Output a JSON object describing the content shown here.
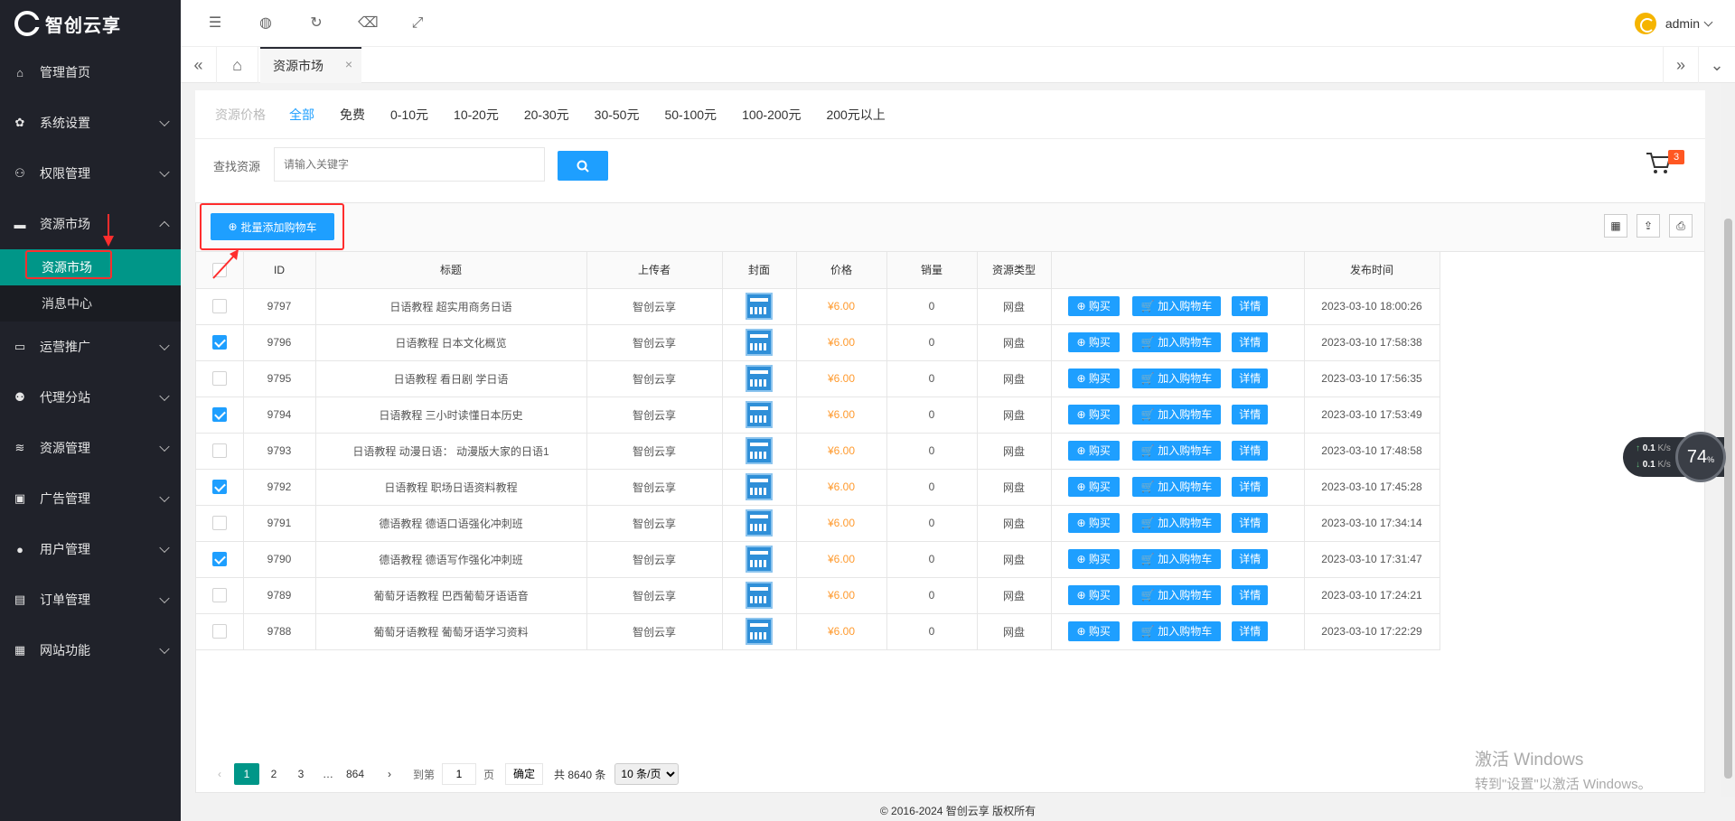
{
  "logo_text": "智创云享",
  "sidebar": {
    "items": [
      {
        "label": "管理首页",
        "icon": "home-icon",
        "glyph": "⌂"
      },
      {
        "label": "系统设置",
        "icon": "gear-icon",
        "glyph": "✿"
      },
      {
        "label": "权限管理",
        "icon": "users-icon",
        "glyph": "⚇"
      },
      {
        "label": "资源市场",
        "icon": "store-icon",
        "glyph": "▬"
      },
      {
        "label": "运营推广",
        "icon": "megaphone-icon",
        "glyph": "▭"
      },
      {
        "label": "代理分站",
        "icon": "sitemap-icon",
        "glyph": "⚉"
      },
      {
        "label": "资源管理",
        "icon": "layers-icon",
        "glyph": "≋"
      },
      {
        "label": "广告管理",
        "icon": "ad-icon",
        "glyph": "▣"
      },
      {
        "label": "用户管理",
        "icon": "user-icon",
        "glyph": "●"
      },
      {
        "label": "订单管理",
        "icon": "clipboard-icon",
        "glyph": "▤"
      },
      {
        "label": "网站功能",
        "icon": "grid-icon",
        "glyph": "▦"
      }
    ],
    "submenu": [
      {
        "label": "资源市场"
      },
      {
        "label": "消息中心"
      }
    ]
  },
  "header": {
    "username": "admin"
  },
  "tabbar": {
    "active_tab": "资源市场",
    "close": "×"
  },
  "filter": {
    "label": "资源价格",
    "options": [
      "全部",
      "免费",
      "0-10元",
      "10-20元",
      "20-30元",
      "30-50元",
      "50-100元",
      "100-200元",
      "200元以上"
    ]
  },
  "search": {
    "label": "查找资源",
    "placeholder": "请输入关键字"
  },
  "cart": {
    "count": "3"
  },
  "toolbar": {
    "batch_add": "批量添加购物车"
  },
  "table": {
    "headers": [
      "ID",
      "标题",
      "上传者",
      "封面",
      "价格",
      "销量",
      "资源类型",
      "",
      "发布时间"
    ],
    "buy_label": "购买",
    "add_cart_label": "加入购物车",
    "detail_label": "详情",
    "rows": [
      {
        "checked": false,
        "id": "9797",
        "title": "日语教程 超实用商务日语",
        "uploader": "智创云享",
        "price": "¥6.00",
        "sales": "0",
        "type": "网盘",
        "time": "2023-03-10 18:00:26"
      },
      {
        "checked": true,
        "id": "9796",
        "title": "日语教程 日本文化概览",
        "uploader": "智创云享",
        "price": "¥6.00",
        "sales": "0",
        "type": "网盘",
        "time": "2023-03-10 17:58:38"
      },
      {
        "checked": false,
        "id": "9795",
        "title": "日语教程 看日剧 学日语",
        "uploader": "智创云享",
        "price": "¥6.00",
        "sales": "0",
        "type": "网盘",
        "time": "2023-03-10 17:56:35"
      },
      {
        "checked": true,
        "id": "9794",
        "title": "日语教程 三小时读懂日本历史",
        "uploader": "智创云享",
        "price": "¥6.00",
        "sales": "0",
        "type": "网盘",
        "time": "2023-03-10 17:53:49"
      },
      {
        "checked": false,
        "id": "9793",
        "title": "日语教程 动漫日语： 动漫版大家的日语1",
        "uploader": "智创云享",
        "price": "¥6.00",
        "sales": "0",
        "type": "网盘",
        "time": "2023-03-10 17:48:58"
      },
      {
        "checked": true,
        "id": "9792",
        "title": "日语教程 职场日语资料教程",
        "uploader": "智创云享",
        "price": "¥6.00",
        "sales": "0",
        "type": "网盘",
        "time": "2023-03-10 17:45:28"
      },
      {
        "checked": false,
        "id": "9791",
        "title": "德语教程 德语口语强化冲刺班",
        "uploader": "智创云享",
        "price": "¥6.00",
        "sales": "0",
        "type": "网盘",
        "time": "2023-03-10 17:34:14"
      },
      {
        "checked": true,
        "id": "9790",
        "title": "德语教程 德语写作强化冲刺班",
        "uploader": "智创云享",
        "price": "¥6.00",
        "sales": "0",
        "type": "网盘",
        "time": "2023-03-10 17:31:47"
      },
      {
        "checked": false,
        "id": "9789",
        "title": "葡萄牙语教程 巴西葡萄牙语语音",
        "uploader": "智创云享",
        "price": "¥6.00",
        "sales": "0",
        "type": "网盘",
        "time": "2023-03-10 17:24:21"
      },
      {
        "checked": false,
        "id": "9788",
        "title": "葡萄牙语教程 葡萄牙语学习资料",
        "uploader": "智创云享",
        "price": "¥6.00",
        "sales": "0",
        "type": "网盘",
        "time": "2023-03-10 17:22:29"
      }
    ]
  },
  "pager": {
    "pages": [
      "1",
      "2",
      "3",
      "…",
      "864"
    ],
    "goto_label": "到第",
    "goto_value": "1",
    "page_unit": "页",
    "ok_label": "确定",
    "total": "共 8640 条",
    "per_page": "10 条/页"
  },
  "footer": "© 2016-2024 智创云享 版权所有",
  "watermark": {
    "line1": "激活 Windows",
    "line2": "转到\"设置\"以激活 Windows。"
  },
  "netmon": {
    "up": "0.1",
    "down": "0.1",
    "unit": "K/s",
    "percent": "74",
    "percent_unit": "%"
  },
  "colors": {
    "accent": "#1e9fff",
    "active_menu": "#009688",
    "price": "#ff9a2e",
    "sidebar": "#20222a"
  }
}
